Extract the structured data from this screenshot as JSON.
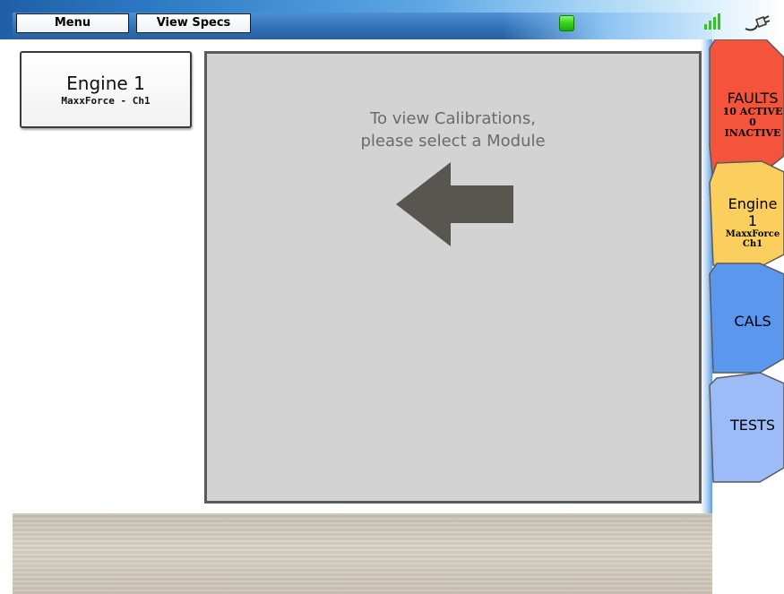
{
  "toolbar": {
    "menu_label": "Menu",
    "view_specs_label": "View Specs",
    "status_icon": "status-led-green",
    "signal_icon": "signal-bars-icon",
    "connection_icon": "plug-icon"
  },
  "modules": [
    {
      "title": "Engine 1",
      "subtitle": "MaxxForce - Ch1"
    }
  ],
  "main": {
    "message_line1": "To view Calibrations,",
    "message_line2": "please select a Module",
    "arrow_icon": "arrow-left-icon"
  },
  "tabs": {
    "faults": {
      "label": "FAULTS",
      "active": "10 ACTIVE",
      "inactive": "0 INACTIVE",
      "color": "#f4533c"
    },
    "engine": {
      "label": "Engine 1",
      "line2": "MaxxForce",
      "line3": "Ch1",
      "color": "#fbcf5e"
    },
    "cals": {
      "label": "CALS",
      "color": "#5b96ef"
    },
    "tests": {
      "label": "TESTS",
      "color": "#9dbcf7"
    }
  }
}
